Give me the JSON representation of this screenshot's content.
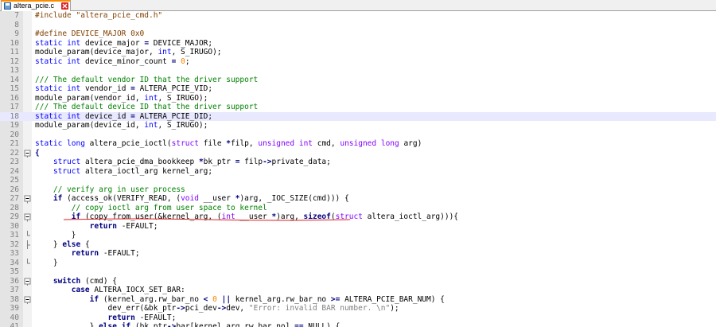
{
  "tab": {
    "filename": "altera_pcie.c",
    "active": true
  },
  "colors": {
    "keyword": "#0000ff",
    "type": "#8000ff",
    "comment": "#008000",
    "preprocessor": "#804000",
    "number": "#ff8000",
    "string": "#808080",
    "current_line": "#e8e8ff",
    "tab_accent": "#fa8c00",
    "close_button": "#e02020"
  },
  "current_line": 18,
  "lines": [
    {
      "n": "7",
      "tokens": [
        {
          "t": "#include \"altera_pcie_cmd.h\"",
          "c": "pp"
        }
      ]
    },
    {
      "n": "8",
      "tokens": []
    },
    {
      "n": "9",
      "tokens": [
        {
          "t": "#define DEVICE_MAJOR 0x0",
          "c": "pp"
        }
      ]
    },
    {
      "n": "10",
      "tokens": [
        {
          "t": "static",
          "c": "kw"
        },
        {
          "t": " "
        },
        {
          "t": "int",
          "c": "kw"
        },
        {
          "t": " device_major "
        },
        {
          "t": "=",
          "c": "op"
        },
        {
          "t": " DEVICE_MAJOR;"
        }
      ]
    },
    {
      "n": "11",
      "tokens": [
        {
          "t": "module_param(device_major, "
        },
        {
          "t": "int",
          "c": "kw"
        },
        {
          "t": ", S_IRUGO);"
        }
      ]
    },
    {
      "n": "12",
      "tokens": [
        {
          "t": "static",
          "c": "kw"
        },
        {
          "t": " "
        },
        {
          "t": "int",
          "c": "kw"
        },
        {
          "t": " device_minor_count "
        },
        {
          "t": "=",
          "c": "op"
        },
        {
          "t": " "
        },
        {
          "t": "0",
          "c": "num"
        },
        {
          "t": ";"
        }
      ]
    },
    {
      "n": "13",
      "tokens": []
    },
    {
      "n": "14",
      "tokens": [
        {
          "t": "/// The default vendor ID that the driver support",
          "c": "cm"
        }
      ]
    },
    {
      "n": "15",
      "tokens": [
        {
          "t": "static",
          "c": "kw"
        },
        {
          "t": " "
        },
        {
          "t": "int",
          "c": "kw"
        },
        {
          "t": " vendor_id "
        },
        {
          "t": "=",
          "c": "op"
        },
        {
          "t": " ALTERA_PCIE_VID;"
        }
      ]
    },
    {
      "n": "16",
      "tokens": [
        {
          "t": "module_param(vendor_id, "
        },
        {
          "t": "int",
          "c": "kw"
        },
        {
          "t": ", S_IRUGO);"
        }
      ]
    },
    {
      "n": "17",
      "tokens": [
        {
          "t": "/// The default device ID that the driver support",
          "c": "cm"
        }
      ]
    },
    {
      "n": "18",
      "tokens": [
        {
          "t": "static",
          "c": "kw"
        },
        {
          "t": " "
        },
        {
          "t": "int",
          "c": "kw"
        },
        {
          "t": " device_id "
        },
        {
          "t": "=",
          "c": "op"
        },
        {
          "t": " ALTERA_PCIE_DID;"
        }
      ]
    },
    {
      "n": "19",
      "tokens": [
        {
          "t": "module_param(device_id, "
        },
        {
          "t": "int",
          "c": "kw"
        },
        {
          "t": ", S_IRUGO);"
        }
      ]
    },
    {
      "n": "20",
      "tokens": []
    },
    {
      "n": "21",
      "tokens": [
        {
          "t": "static",
          "c": "kw"
        },
        {
          "t": " "
        },
        {
          "t": "long",
          "c": "kw"
        },
        {
          "t": " altera_pcie_ioctl("
        },
        {
          "t": "struct",
          "c": "kw2"
        },
        {
          "t": " file "
        },
        {
          "t": "*",
          "c": "op"
        },
        {
          "t": "filp, "
        },
        {
          "t": "unsigned",
          "c": "kw2"
        },
        {
          "t": " "
        },
        {
          "t": "int",
          "c": "kw2"
        },
        {
          "t": " cmd, "
        },
        {
          "t": "unsigned",
          "c": "kw2"
        },
        {
          "t": " "
        },
        {
          "t": "long",
          "c": "kw2"
        },
        {
          "t": " arg)"
        }
      ]
    },
    {
      "n": "22",
      "fold": "open",
      "tokens": [
        {
          "t": "{",
          "c": "op"
        }
      ]
    },
    {
      "n": "23",
      "tokens": [
        {
          "t": "    "
        },
        {
          "t": "struct",
          "c": "kw"
        },
        {
          "t": " altera_pcie_dma_bookkeep "
        },
        {
          "t": "*",
          "c": "op"
        },
        {
          "t": "bk_ptr "
        },
        {
          "t": "=",
          "c": "op"
        },
        {
          "t": " filp"
        },
        {
          "t": "->",
          "c": "op"
        },
        {
          "t": "private_data;"
        }
      ]
    },
    {
      "n": "24",
      "tokens": [
        {
          "t": "    "
        },
        {
          "t": "struct",
          "c": "kw"
        },
        {
          "t": " altera_ioctl_arg kernel_arg;"
        }
      ]
    },
    {
      "n": "25",
      "tokens": []
    },
    {
      "n": "26",
      "tokens": [
        {
          "t": "    "
        },
        {
          "t": "// verify arg in user process",
          "c": "cm"
        }
      ]
    },
    {
      "n": "27",
      "fold": "open",
      "tokens": [
        {
          "t": "    "
        },
        {
          "t": "if",
          "c": "bold"
        },
        {
          "t": " (access_ok(VERIFY_READ, ("
        },
        {
          "t": "void",
          "c": "kw2"
        },
        {
          "t": " __user "
        },
        {
          "t": "*",
          "c": "op"
        },
        {
          "t": ")arg, _IOC_SIZE(cmd))) {"
        }
      ]
    },
    {
      "n": "28",
      "tokens": [
        {
          "t": "        "
        },
        {
          "t": "// copy ioctl arg from user space to kernel",
          "c": "cm"
        }
      ]
    },
    {
      "n": "29",
      "fold": "open",
      "tokens": [
        {
          "t": "        "
        },
        {
          "t": "if",
          "c": "bold"
        },
        {
          "t": " (copy_from_user(&kernel_arg, ("
        },
        {
          "t": "int",
          "c": "kw2"
        },
        {
          "t": " __user "
        },
        {
          "t": "*",
          "c": "op"
        },
        {
          "t": ")arg, "
        },
        {
          "t": "sizeof",
          "c": "bold"
        },
        {
          "t": "("
        },
        {
          "t": "struct",
          "c": "kw2"
        },
        {
          "t": " altera_ioctl_arg))){"
        }
      ]
    },
    {
      "n": "30",
      "tokens": [
        {
          "t": "            "
        },
        {
          "t": "return",
          "c": "bold"
        },
        {
          "t": " -EFAULT;"
        }
      ]
    },
    {
      "n": "31",
      "fold": "end",
      "tokens": [
        {
          "t": "        }"
        }
      ]
    },
    {
      "n": "32",
      "fold": "mid",
      "tokens": [
        {
          "t": "    } "
        },
        {
          "t": "else",
          "c": "bold"
        },
        {
          "t": " {"
        }
      ]
    },
    {
      "n": "33",
      "tokens": [
        {
          "t": "        "
        },
        {
          "t": "return",
          "c": "bold"
        },
        {
          "t": " -EFAULT;"
        }
      ]
    },
    {
      "n": "34",
      "fold": "end",
      "tokens": [
        {
          "t": "    }"
        }
      ]
    },
    {
      "n": "35",
      "tokens": []
    },
    {
      "n": "36",
      "fold": "open",
      "tokens": [
        {
          "t": "    "
        },
        {
          "t": "switch",
          "c": "bold"
        },
        {
          "t": " (cmd) {"
        }
      ]
    },
    {
      "n": "37",
      "tokens": [
        {
          "t": "        "
        },
        {
          "t": "case",
          "c": "bold"
        },
        {
          "t": " ALTERA_IOCX_SET_BAR:"
        }
      ]
    },
    {
      "n": "38",
      "fold": "open",
      "tokens": [
        {
          "t": "            "
        },
        {
          "t": "if",
          "c": "bold"
        },
        {
          "t": " (kernel_arg.rw_bar_no "
        },
        {
          "t": "<",
          "c": "op"
        },
        {
          "t": " "
        },
        {
          "t": "0",
          "c": "num"
        },
        {
          "t": " "
        },
        {
          "t": "||",
          "c": "op"
        },
        {
          "t": " kernel_arg.rw_bar_no "
        },
        {
          "t": ">=",
          "c": "op"
        },
        {
          "t": " ALTERA_PCIE_BAR_NUM) {"
        }
      ]
    },
    {
      "n": "39",
      "tokens": [
        {
          "t": "                dev_err(&bk_ptr"
        },
        {
          "t": "->",
          "c": "op"
        },
        {
          "t": "pci_dev"
        },
        {
          "t": "->",
          "c": "op"
        },
        {
          "t": "dev, "
        },
        {
          "t": "\"Error: invalid BAR number. \\n\"",
          "c": "str"
        },
        {
          "t": ");"
        }
      ]
    },
    {
      "n": "40",
      "tokens": [
        {
          "t": "                "
        },
        {
          "t": "return",
          "c": "bold"
        },
        {
          "t": " -EFAULT;"
        }
      ]
    },
    {
      "n": "41",
      "tokens": [
        {
          "t": "            } "
        },
        {
          "t": "else",
          "c": "bold"
        },
        {
          "t": " "
        },
        {
          "t": "if",
          "c": "bold"
        },
        {
          "t": " (bk_ptr"
        },
        {
          "t": "->",
          "c": "op"
        },
        {
          "t": "bar[kernel_arg.rw_bar_no] "
        },
        {
          "t": "==",
          "c": "op"
        },
        {
          "t": " NULL) {"
        }
      ]
    }
  ]
}
